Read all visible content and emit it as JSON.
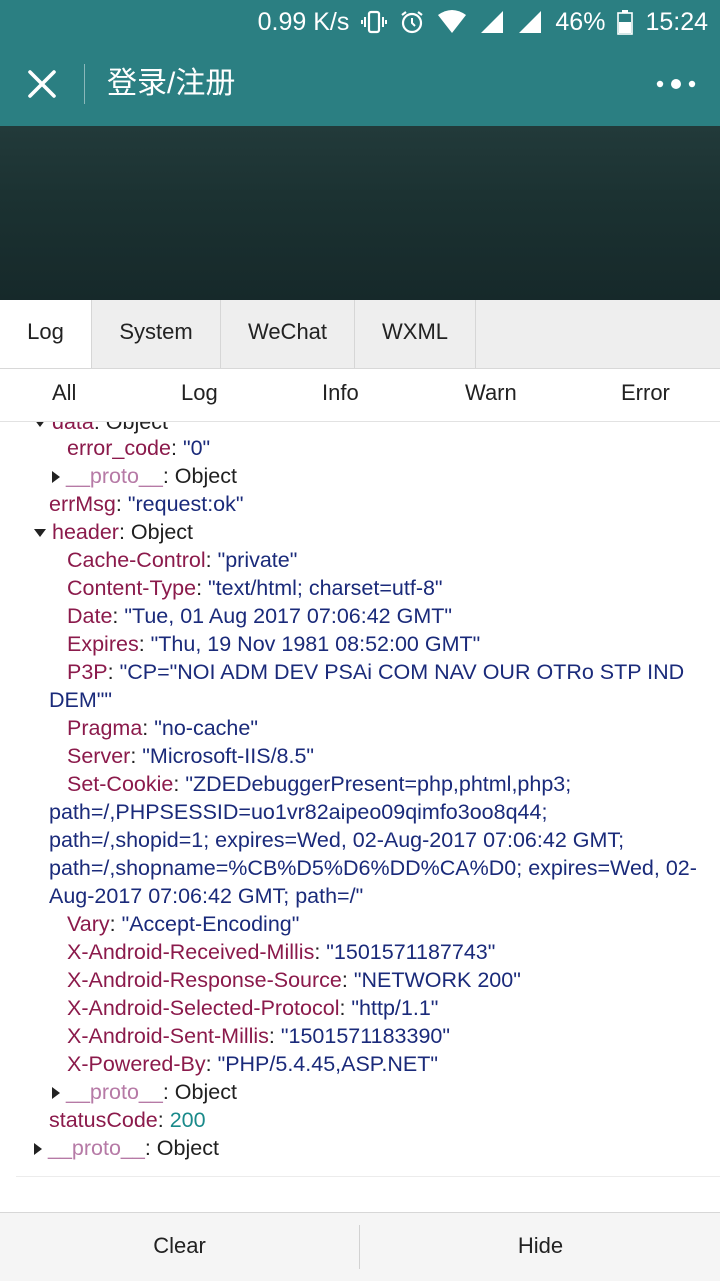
{
  "status_bar": {
    "network_speed": "0.99 K/s",
    "battery": "46%",
    "time": "15:24",
    "icons": [
      "vibrate-icon",
      "alarm-icon",
      "wifi-icon",
      "signal-icon",
      "signal-icon",
      "battery-icon"
    ]
  },
  "nav": {
    "title": "登录/注册",
    "close_icon": "close-icon",
    "more_icon": "more-icon"
  },
  "tabs": [
    "Log",
    "System",
    "WeChat",
    "WXML"
  ],
  "active_tab": "Log",
  "levels": [
    "All",
    "Log",
    "Info",
    "Warn",
    "Error"
  ],
  "console": {
    "data_key": "data",
    "data_type": "Object",
    "error_code_key": "error_code",
    "error_code_val": "\"0\"",
    "proto_key": "__proto__",
    "proto_type": "Object",
    "errmsg_key": "errMsg",
    "errmsg_val": "\"request:ok\"",
    "header_key": "header",
    "header_type": "Object",
    "headers": [
      {
        "k": "Cache-Control",
        "v": "\"private\""
      },
      {
        "k": "Content-Type",
        "v": "\"text/html; charset=utf-8\""
      },
      {
        "k": "Date",
        "v": "\"Tue, 01 Aug 2017 07:06:42 GMT\""
      },
      {
        "k": "Expires",
        "v": "\"Thu, 19 Nov 1981 08:52:00 GMT\""
      },
      {
        "k": "P3P",
        "v": "\"CP=\"NOI ADM DEV PSAi COM NAV OUR OTRo STP IND",
        "v2": "DEM\"\""
      },
      {
        "k": "Pragma",
        "v": "\"no-cache\""
      },
      {
        "k": "Server",
        "v": "\"Microsoft-IIS/8.5\""
      },
      {
        "k": "Set-Cookie",
        "v": "\"ZDEDebuggerPresent=php,phtml,php3;",
        "v2": "path=/,PHPSESSID=uo1vr82aipeo09qimfo3oo8q44;",
        "v3": "path=/,shopid=1; expires=Wed, 02-Aug-2017 07:06:42 GMT;",
        "v4": "path=/,shopname=%CB%D5%D6%DD%CA%D0; expires=Wed, 02-",
        "v5": "Aug-2017 07:06:42 GMT; path=/\""
      },
      {
        "k": "Vary",
        "v": "\"Accept-Encoding\""
      },
      {
        "k": "X-Android-Received-Millis",
        "v": "\"1501571187743\""
      },
      {
        "k": "X-Android-Response-Source",
        "v": "\"NETWORK 200\""
      },
      {
        "k": "X-Android-Selected-Protocol",
        "v": "\"http/1.1\""
      },
      {
        "k": "X-Android-Sent-Millis",
        "v": "\"1501571183390\""
      },
      {
        "k": "X-Powered-By",
        "v": "\"PHP/5.4.45,ASP.NET\""
      }
    ],
    "statuscode_key": "statusCode",
    "statuscode_val": "200"
  },
  "bottom": {
    "clear": "Clear",
    "hide": "Hide"
  }
}
